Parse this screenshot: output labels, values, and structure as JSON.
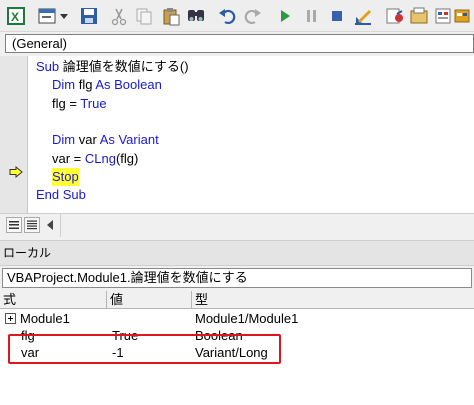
{
  "toolbar": {
    "buttons": [
      {
        "name": "view-excel-icon"
      },
      {
        "name": "insert-module-icon"
      },
      {
        "name": "save-icon"
      },
      {
        "name": "cut-icon"
      },
      {
        "name": "copy-icon"
      },
      {
        "name": "paste-icon"
      },
      {
        "name": "find-icon"
      },
      {
        "name": "undo-icon"
      },
      {
        "name": "redo-icon"
      },
      {
        "name": "run-icon"
      },
      {
        "name": "break-icon"
      },
      {
        "name": "reset-icon"
      },
      {
        "name": "design-mode-icon"
      },
      {
        "name": "project-explorer-icon"
      },
      {
        "name": "properties-window-icon"
      },
      {
        "name": "object-browser-icon"
      },
      {
        "name": "toolbox-icon"
      }
    ]
  },
  "editor": {
    "object_combo": "(General)",
    "code_lines": [
      {
        "indent": 0,
        "parts": [
          {
            "t": "Sub ",
            "kw": true
          },
          {
            "t": "論理値を数値にする()",
            "kw": false
          }
        ]
      },
      {
        "indent": 1,
        "parts": [
          {
            "t": "Dim ",
            "kw": true
          },
          {
            "t": "flg ",
            "kw": false
          },
          {
            "t": "As Boolean",
            "kw": true
          }
        ]
      },
      {
        "indent": 1,
        "parts": [
          {
            "t": "flg = ",
            "kw": false
          },
          {
            "t": "True",
            "kw": true
          }
        ]
      },
      {
        "indent": 0,
        "parts": []
      },
      {
        "indent": 1,
        "parts": [
          {
            "t": "Dim ",
            "kw": true
          },
          {
            "t": "var ",
            "kw": false
          },
          {
            "t": "As Variant",
            "kw": true
          }
        ]
      },
      {
        "indent": 1,
        "parts": [
          {
            "t": "var = ",
            "kw": false
          },
          {
            "t": "CLng",
            "kw": true
          },
          {
            "t": "(flg)",
            "kw": false
          }
        ]
      },
      {
        "indent": 1,
        "highlight": true,
        "parts": [
          {
            "t": "Stop",
            "kw": true
          }
        ]
      },
      {
        "indent": 0,
        "parts": [
          {
            "t": "End Sub",
            "kw": true
          }
        ]
      }
    ],
    "current_line_indicator": "arrow-icon"
  },
  "locals": {
    "title": "ローカル",
    "context": "VBAProject.Module1.論理値を数値にする",
    "columns": [
      "式",
      "値",
      "型"
    ],
    "rows": [
      {
        "expr": "Module1",
        "value": "",
        "type": "Module1/Module1",
        "expandable": true
      },
      {
        "expr": "flg",
        "value": "True",
        "type": "Boolean",
        "expandable": false
      },
      {
        "expr": "var",
        "value": "-1",
        "type": "Variant/Long",
        "expandable": false
      }
    ],
    "highlight_color": "#e0151d"
  },
  "colors": {
    "keyword": "#1a1ad6",
    "execution_highlight": "#ffff33"
  }
}
